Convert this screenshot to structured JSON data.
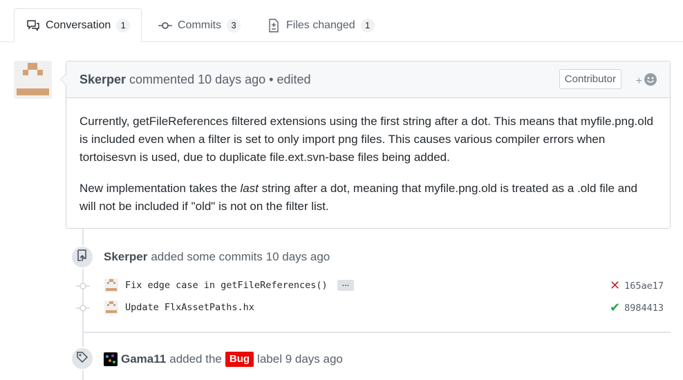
{
  "tabs": [
    {
      "label": "Conversation",
      "count": "1",
      "icon": "comment-discussion-icon"
    },
    {
      "label": "Commits",
      "count": "3",
      "icon": "git-commit-icon"
    },
    {
      "label": "Files changed",
      "count": "1",
      "icon": "file-diff-icon"
    }
  ],
  "comment": {
    "author": "Skerper",
    "meta": "commented 10 days ago • edited",
    "role_badge": "Contributor",
    "reaction_plus": "+",
    "body_p1": "Currently, getFileReferences filtered extensions using the first string after a dot. This means that myfile.png.old is included even when a filter is set to only import png files. This causes various compiler errors when tortoisesvn is used, due to duplicate file.ext.svn-base files being added.",
    "body_p2_before": "New implementation takes the ",
    "body_p2_em": "last",
    "body_p2_after": " string after a dot, meaning that myfile.png.old is treated as a .old file and will not be included if \"old\" is not on the filter list."
  },
  "commits_event": {
    "author": "Skerper",
    "text": "added some commits 10 days ago",
    "commits": [
      {
        "message": "Fix edge case in getFileReferences()",
        "ellipsis": "…",
        "status": "fail",
        "status_icon": "x-icon",
        "sha": "165ae17"
      },
      {
        "message": "Update FlxAssetPaths.hx",
        "status": "success",
        "status_icon": "check-icon",
        "sha": "8984413"
      }
    ]
  },
  "label_event": {
    "author": "Gama11",
    "text_before": "added the",
    "label": "Bug",
    "label_color": "#ee0701",
    "text_after": "label 9 days ago"
  }
}
